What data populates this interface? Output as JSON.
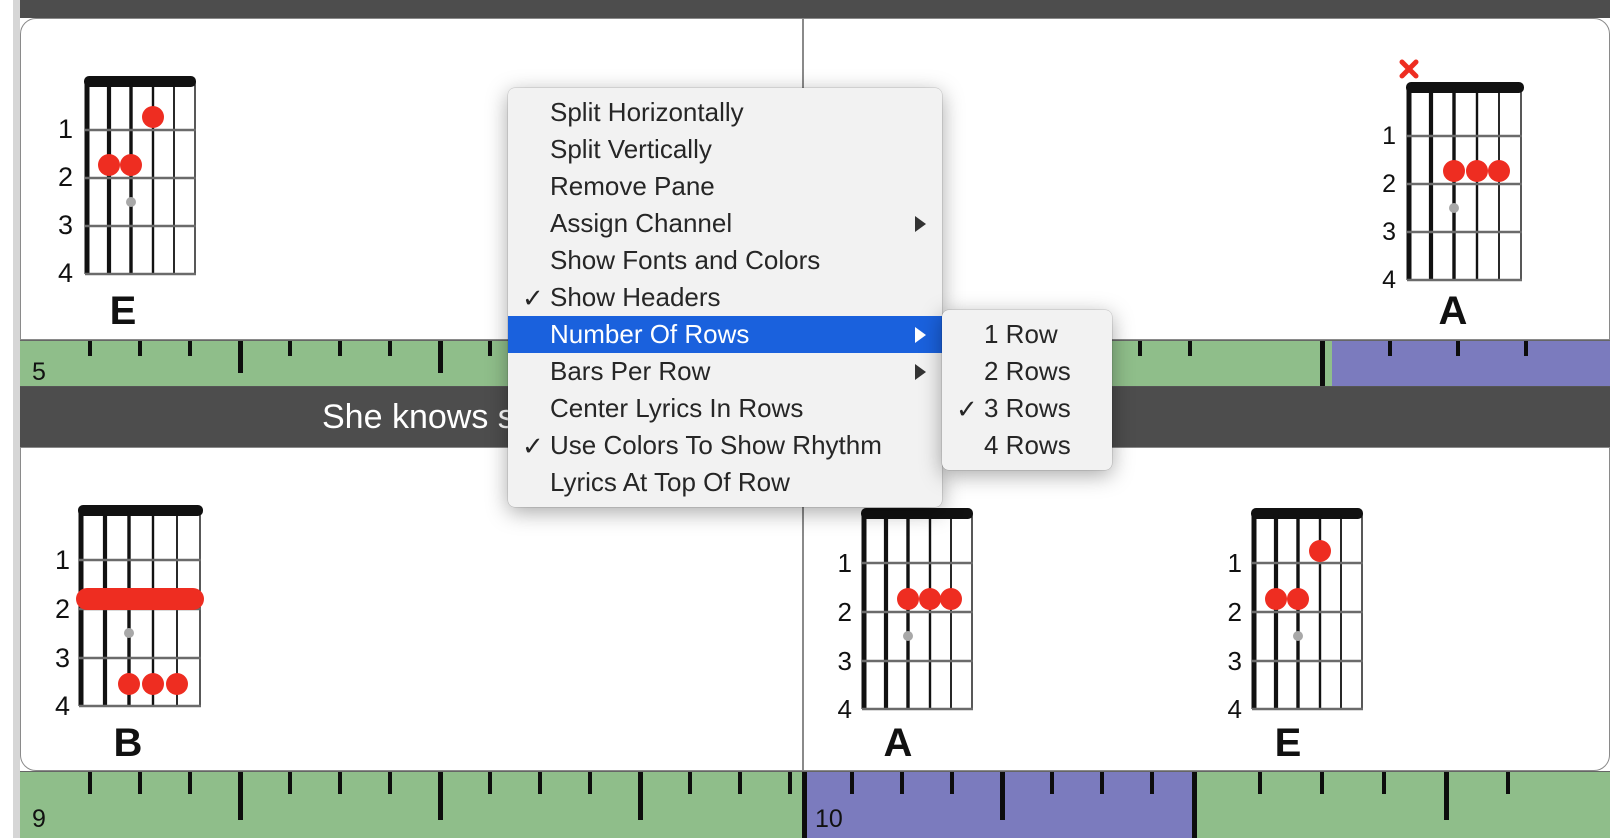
{
  "window": {
    "background_color": "#ffffff",
    "top_bar_color": "#4d4d4d"
  },
  "colors": {
    "ruler_green": "#8fbe8a",
    "ruler_purple": "#7b7bbe",
    "lyric_strip": "#4d4d4d",
    "menu_highlight": "#1a61dd",
    "chord_dot": "#ee2d21",
    "chord_muted_x": "#ee2d21",
    "chord_ghost_dot": "#a8a8a8"
  },
  "rows": [
    {
      "name": "row-1",
      "panes": [
        {
          "name": "pane-top-left",
          "chords": [
            {
              "name": "E",
              "fret_labels": [
                "1",
                "2",
                "3",
                "4"
              ],
              "dots": [
                {
                  "string": 4,
                  "fret": 1
                },
                {
                  "string": 3,
                  "fret": 2
                },
                {
                  "string": 2,
                  "fret": 2
                }
              ],
              "ghost_dots": [
                {
                  "string": 3,
                  "fret": 2.5
                }
              ],
              "barres": [],
              "muted_strings": []
            }
          ]
        },
        {
          "name": "pane-top-right",
          "chords": [
            {
              "name": "A",
              "fret_labels": [
                "1",
                "2",
                "3",
                "4"
              ],
              "dots": [
                {
                  "string": 3,
                  "fret": 2
                },
                {
                  "string": 4,
                  "fret": 2
                },
                {
                  "string": 5,
                  "fret": 2
                }
              ],
              "ghost_dots": [
                {
                  "string": 3,
                  "fret": 2.5
                }
              ],
              "barres": [],
              "muted_strings": [
                1
              ]
            }
          ]
        }
      ],
      "ruler": {
        "name": "ruler-row-1",
        "start_bar_label": "5",
        "segments": [
          {
            "color": "#8fbe8a",
            "left_pct": 0,
            "width_pct": 82.5
          },
          {
            "color": "#7b7bbe",
            "left_pct": 82.5,
            "width_pct": 17.5
          }
        ]
      },
      "lyrics": {
        "name": "lyric-strip-row-1",
        "text": "She knows something 'bout everything"
      }
    },
    {
      "name": "row-2",
      "panes": [
        {
          "name": "pane-bottom-left",
          "chords": [
            {
              "name": "B",
              "fret_labels": [
                "1",
                "2",
                "3",
                "4"
              ],
              "dots": [
                {
                  "string": 3,
                  "fret": 4
                },
                {
                  "string": 4,
                  "fret": 4
                },
                {
                  "string": 5,
                  "fret": 4
                }
              ],
              "ghost_dots": [
                {
                  "string": 3,
                  "fret": 2.5
                }
              ],
              "barres": [
                {
                  "fret": 2,
                  "from_string": 1,
                  "to_string": 6
                }
              ],
              "muted_strings": []
            }
          ]
        },
        {
          "name": "pane-bottom-right",
          "chords": [
            {
              "name": "A",
              "fret_labels": [
                "1",
                "2",
                "3",
                "4"
              ],
              "dots": [
                {
                  "string": 3,
                  "fret": 2
                },
                {
                  "string": 4,
                  "fret": 2
                },
                {
                  "string": 5,
                  "fret": 2
                }
              ],
              "ghost_dots": [
                {
                  "string": 3,
                  "fret": 2.5
                }
              ],
              "barres": [],
              "muted_strings": []
            },
            {
              "name": "E",
              "fret_labels": [
                "1",
                "2",
                "3",
                "4"
              ],
              "dots": [
                {
                  "string": 4,
                  "fret": 1
                },
                {
                  "string": 3,
                  "fret": 2
                },
                {
                  "string": 2,
                  "fret": 2
                }
              ],
              "ghost_dots": [
                {
                  "string": 3,
                  "fret": 2.5
                }
              ],
              "barres": [],
              "muted_strings": []
            }
          ]
        }
      ],
      "ruler": {
        "name": "ruler-row-2",
        "start_bar_label": "9",
        "mid_bar_label": "10",
        "segments": [
          {
            "color": "#8fbe8a",
            "left_pct": 0,
            "width_pct": 49.2
          },
          {
            "color": "#7b7bbe",
            "left_pct": 49.2,
            "width_pct": 24.5
          },
          {
            "color": "#8fbe8a",
            "left_pct": 73.7,
            "width_pct": 26.3
          }
        ]
      }
    }
  ],
  "context_menu": {
    "name": "pane-context-menu",
    "items": [
      {
        "label": "Split Horizontally",
        "checked": false,
        "submenu": false,
        "highlighted": false
      },
      {
        "label": "Split Vertically",
        "checked": false,
        "submenu": false,
        "highlighted": false
      },
      {
        "label": "Remove Pane",
        "checked": false,
        "submenu": false,
        "highlighted": false
      },
      {
        "label": "Assign Channel",
        "checked": false,
        "submenu": true,
        "highlighted": false
      },
      {
        "label": "Show Fonts and Colors",
        "checked": false,
        "submenu": false,
        "highlighted": false
      },
      {
        "label": "Show Headers",
        "checked": true,
        "submenu": false,
        "highlighted": false
      },
      {
        "label": "Number Of Rows",
        "checked": false,
        "submenu": true,
        "highlighted": true
      },
      {
        "label": "Bars Per Row",
        "checked": false,
        "submenu": true,
        "highlighted": false
      },
      {
        "label": "Center Lyrics In Rows",
        "checked": false,
        "submenu": false,
        "highlighted": false
      },
      {
        "label": "Use Colors To Show Rhythm",
        "checked": true,
        "submenu": false,
        "highlighted": false
      },
      {
        "label": "Lyrics At Top Of Row",
        "checked": false,
        "submenu": false,
        "highlighted": false
      }
    ],
    "submenu": {
      "name": "number-of-rows-submenu",
      "items": [
        {
          "label": "1 Row",
          "checked": false
        },
        {
          "label": "2 Rows",
          "checked": false
        },
        {
          "label": "3 Rows",
          "checked": true
        },
        {
          "label": "4 Rows",
          "checked": false
        }
      ]
    },
    "check_glyph": "✓",
    "arrow_glyph": "▶"
  }
}
